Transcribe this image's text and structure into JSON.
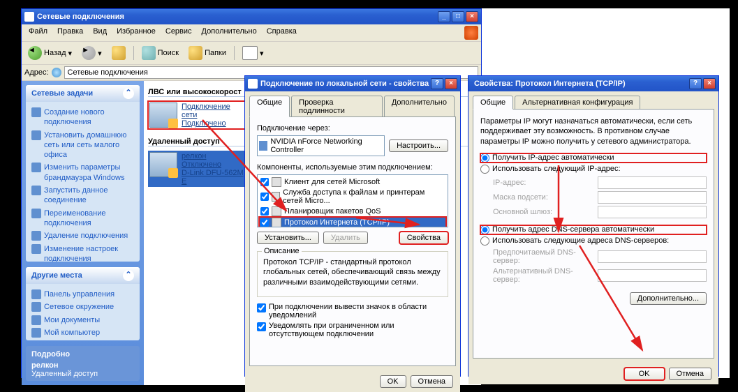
{
  "explorer": {
    "title": "Сетевые подключения",
    "menu": [
      "Файл",
      "Правка",
      "Вид",
      "Избранное",
      "Сервис",
      "Дополнительно",
      "Справка"
    ],
    "tb": {
      "back": "Назад",
      "search": "Поиск",
      "folders": "Папки"
    },
    "address_label": "Адрес:",
    "address_value": "Сетевые подключения",
    "side": {
      "tasks_hdr": "Сетевые задачи",
      "tasks": [
        "Создание нового подключения",
        "Установить домашнюю сеть или сеть малого офиса",
        "Изменить параметры брандмауэра Windows",
        "Запустить данное соединение",
        "Переименование подключения",
        "Удаление подключения",
        "Изменение настроек подключения"
      ],
      "other_hdr": "Другие места",
      "other": [
        "Панель управления",
        "Сетевое окружение",
        "Мои документы",
        "Мой компьютер"
      ],
      "details_hdr": "Подробно",
      "details_name": "релкон",
      "details_status": "Удаленный доступ"
    },
    "content": {
      "group1": "ЛВС или высокоскорост",
      "conn1_a": "Подключение",
      "conn1_b": "сети",
      "conn1_c": "Подключено",
      "group2": "Удаленный доступ",
      "conn2_a": "релкон",
      "conn2_b": "Отключено",
      "conn2_c": "D-Link DFU-562M E"
    }
  },
  "dlg1": {
    "title": "Подключение по локальной сети - свойства",
    "tabs": [
      "Общие",
      "Проверка подлинности",
      "Дополнительно"
    ],
    "connect_via": "Подключение через:",
    "adapter": "NVIDIA nForce Networking Controller",
    "configure_btn": "Настроить...",
    "components_lbl": "Компоненты, используемые этим подключением:",
    "components": [
      {
        "checked": true,
        "label": "Клиент для сетей Microsoft"
      },
      {
        "checked": true,
        "label": "Служба доступа к файлам и принтерам сетей Micro..."
      },
      {
        "checked": true,
        "label": "Планировщик пакетов QoS"
      },
      {
        "checked": true,
        "label": "Протокол Интернета (TCP/IP)",
        "selected": true
      }
    ],
    "install_btn": "Установить...",
    "remove_btn": "Удалить",
    "props_btn": "Свойства",
    "desc_hdr": "Описание",
    "desc_txt": "Протокол TCP/IP - стандартный протокол глобальных сетей, обеспечивающий связь между различными взаимодействующими сетями.",
    "chk_tray": "При подключении вывести значок в области уведомлений",
    "chk_notify": "Уведомлять при ограниченном или отсутствующем подключении",
    "ok": "OK",
    "cancel": "Отмена"
  },
  "dlg2": {
    "title": "Свойства: Протокол Интернета (TCP/IP)",
    "tabs": [
      "Общие",
      "Альтернативная конфигурация"
    ],
    "intro": "Параметры IP могут назначаться автоматически, если сеть поддерживает эту возможность. В противном случае параметры IP можно получить у сетевого администратора.",
    "r_auto_ip": "Получить IP-адрес автоматически",
    "r_manual_ip": "Использовать следующий IP-адрес:",
    "ip_label": "IP-адрес:",
    "mask_label": "Маска подсети:",
    "gw_label": "Основной шлюз:",
    "r_auto_dns": "Получить адрес DNS-сервера автоматически",
    "r_manual_dns": "Использовать следующие адреса DNS-серверов:",
    "dns1": "Предпочитаемый DNS-сервер:",
    "dns2": "Альтернативный DNS-сервер:",
    "advanced_btn": "Дополнительно...",
    "ok": "OK",
    "cancel": "Отмена"
  }
}
